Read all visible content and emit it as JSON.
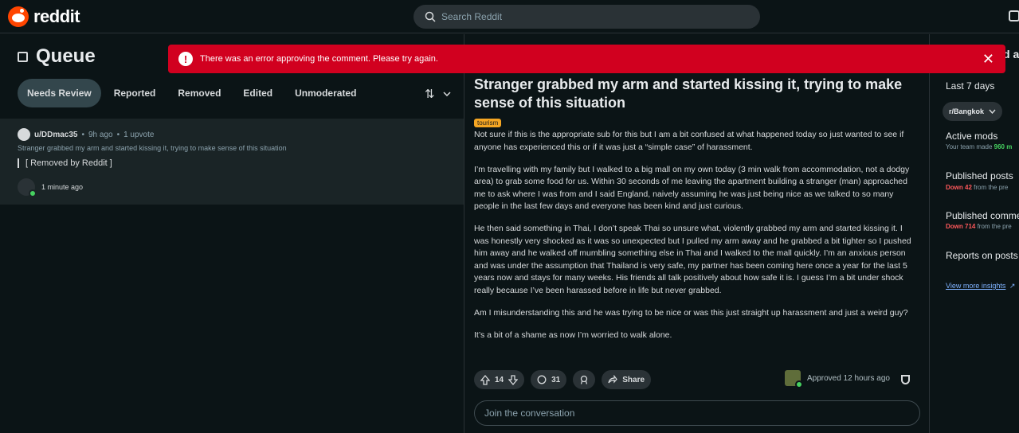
{
  "app": {
    "name": "reddit"
  },
  "search": {
    "placeholder": "Search Reddit"
  },
  "queue": {
    "title": "Queue",
    "tabs": [
      "Needs Review",
      "Reported",
      "Removed",
      "Edited",
      "Unmoderated"
    ],
    "active_tab": "Needs Review",
    "items": [
      {
        "user": "u/DDmac35",
        "age": "9h ago",
        "votes": "1 upvote",
        "post_title": "Stranger grabbed my arm and started kissing it, trying to make sense of this situation",
        "status": "[ Removed by Reddit ]",
        "mod_time": "1 minute ago"
      }
    ]
  },
  "toast": {
    "message": "There was an error approving the comment. Please try again.",
    "close_icon": "close-icon"
  },
  "post": {
    "title": "Stranger grabbed my arm and started kissing it, trying to make sense of this situation",
    "flair": "tourism",
    "paragraphs": [
      "Not sure if this is the appropriate sub for this but I am a bit confused at what happened today so just wanted to see if anyone has experienced this or if it was just a “simple case” of harassment.",
      "I’m travelling with my family but I walked to a big mall on my own today (3 min walk from accommodation, not a dodgy area) to grab some food for us. Within 30 seconds of me leaving the apartment building a stranger (man) approached me to ask where I was from and I said England, naively assuming he was just being nice as we talked to so many people in the last few days and everyone has been kind and just curious.",
      "He then said something in Thai, I don’t speak Thai so unsure what, violently grabbed my arm and started kissing it. I was honestly very shocked as it was so unexpected but I pulled my arm away and he grabbed a bit tighter so I pushed him away and he walked off mumbling something else in Thai and I walked to the mall quickly. I’m an anxious person and was under the assumption that Thailand is very safe, my partner has been coming here once a year for the last 5 years now and stays for many weeks. His friends all talk positively about how safe it is. I guess I’m a bit under shock really because I’ve been harassed before in life but never grabbed.",
      "Am I misunderstanding this and he was trying to be nice or was this just straight up harassment and just a weird guy?",
      "It’s a bit of a shame as now I’m worried to walk alone."
    ],
    "score": "14",
    "comments": "31",
    "share_label": "Share",
    "approved": "Approved 12 hours ago",
    "comment_placeholder": "Join the conversation"
  },
  "insights": {
    "title_partial": "d a",
    "range": "Last 7 days",
    "subreddit": "r/Bangkok",
    "active_mods": {
      "title": "Active mods",
      "text": "Your team made",
      "value": "960 m"
    },
    "published_posts": {
      "title": "Published posts",
      "delta": "Down 42",
      "text": "from the pre"
    },
    "published_comments": {
      "title": "Published comme",
      "delta": "Down 714",
      "text": "from the pre"
    },
    "reports": {
      "title": "Reports on posts"
    },
    "link": "View more insights"
  },
  "colors": {
    "accent": "#ff4500",
    "error": "#d1001f",
    "positive": "#46d160",
    "negative": "#ff585b",
    "flair": "#f5a623"
  }
}
